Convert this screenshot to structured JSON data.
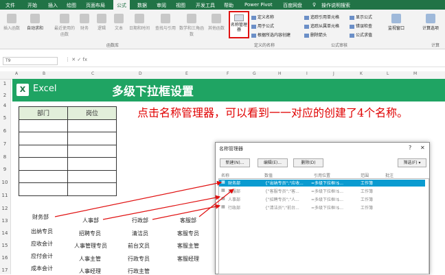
{
  "tabs": [
    "文件",
    "开始",
    "插入",
    "绘图",
    "页面布局",
    "公式",
    "数据",
    "审阅",
    "视图",
    "开发工具",
    "帮助",
    "Power Pivot",
    "百度网盘",
    "操作说明搜索"
  ],
  "ribbon": {
    "buttons": [
      "插入函数",
      "自动求和",
      "最近使用的函数",
      "财务",
      "逻辑",
      "文本",
      "日期和时间",
      "查找与引用",
      "数学和三角函数",
      "其他函数"
    ],
    "group_lib": "函数库",
    "name_manager": "名称管理器",
    "define": [
      "定义名称",
      "用于公式",
      "根据所选内容创建"
    ],
    "group_names": "定义的名称",
    "audit": [
      "追踪引用单元格",
      "追踪从属单元格",
      "删除箭头",
      "显示公式",
      "错误检查",
      "公式求值"
    ],
    "group_audit": "公式审核",
    "watch": "监视窗口",
    "calc": "计算选项",
    "group_calc": "计算"
  },
  "namebox": "T9",
  "columns": [
    "A",
    "B",
    "C",
    "D",
    "E",
    "F",
    "G",
    "H",
    "I",
    "J",
    "K",
    "L",
    "M"
  ],
  "rows": [
    "1",
    "2",
    "3",
    "4",
    "5",
    "6",
    "7",
    "8",
    "9",
    "10",
    "11",
    "12",
    "13",
    "14",
    "15",
    "16",
    "17",
    "18"
  ],
  "banner": {
    "logo": "X",
    "app": "Excel",
    "title": "多级下拉框设置"
  },
  "table": {
    "h1": "部门",
    "h2": "岗位"
  },
  "instruction": "点击名称管理器，可以看到一一对应的创建了4个名称。",
  "cells": {
    "finance": "财务部",
    "hr": "人事部",
    "admin": "行政部",
    "service": "客服部",
    "c1": [
      "出纳专员",
      "应收会计",
      "应付会计",
      "成本会计"
    ],
    "c2": [
      "招聘专员",
      "人事管理专员",
      "人事主管",
      "人事经理"
    ],
    "c3": [
      "清洁员",
      "前台文员",
      "行政专员",
      "行政主管"
    ],
    "c4": [
      "客服专员",
      "客服主管",
      "客服经理"
    ]
  },
  "dialog": {
    "title": "名称管理器",
    "help": "?",
    "close": "✕",
    "buttons": [
      "新建(N)...",
      "编辑(E)...",
      "删除(D)",
      "筛选(F) ▾"
    ],
    "headers": [
      "名称",
      "数值",
      "引用位置",
      "范围",
      "批注"
    ],
    "rows": [
      {
        "name": "财务部",
        "value": "{\"出纳专员\";\"应收...",
        "ref": "=多级下拉框!$...",
        "scope": "工作簿"
      },
      {
        "name": "客服部",
        "value": "{\"客服专员\";\"客...",
        "ref": "=多级下拉框!$...",
        "scope": "工作簿"
      },
      {
        "name": "人事部",
        "value": "{\"招聘专员\";\"人...",
        "ref": "=多级下拉框!$...",
        "scope": "工作簿"
      },
      {
        "name": "行政部",
        "value": "{\"清洁员\";\"前台...",
        "ref": "=多级下拉框!$...",
        "scope": "工作簿"
      }
    ]
  }
}
